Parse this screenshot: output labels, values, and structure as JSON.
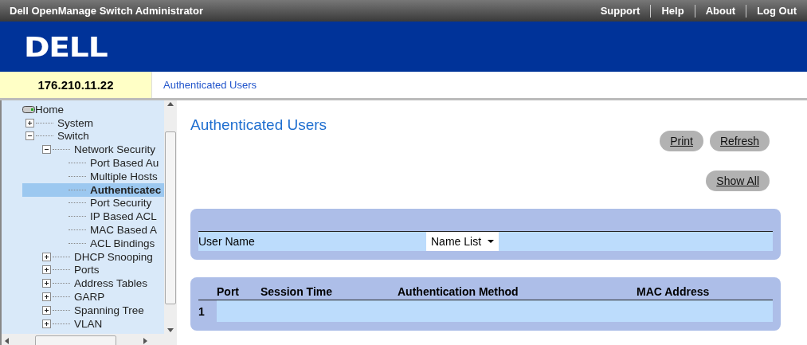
{
  "top_bar": {
    "title": "Dell OpenManage Switch Administrator",
    "links": [
      "Support",
      "Help",
      "About",
      "Log Out"
    ]
  },
  "logo": {
    "text": "DELL"
  },
  "address_bar": {
    "device_ip": "176.210.11.22",
    "breadcrumb": "Authenticated Users"
  },
  "tree": {
    "root": "Home",
    "items": [
      {
        "label": "System",
        "kind": "folder",
        "expanded": false,
        "selected": false
      },
      {
        "label": "Switch",
        "kind": "folder",
        "expanded": true,
        "selected": false,
        "children": [
          {
            "label": "Network Security",
            "kind": "folder",
            "expanded": true,
            "selected": false,
            "children": [
              {
                "label": "Port Based Au",
                "kind": "leaf",
                "selected": false
              },
              {
                "label": "Multiple Hosts",
                "kind": "leaf",
                "selected": false
              },
              {
                "label": "Authenticatec",
                "kind": "leaf",
                "selected": true
              },
              {
                "label": "Port Security",
                "kind": "leaf",
                "selected": false
              },
              {
                "label": "IP Based ACL",
                "kind": "leaf",
                "selected": false
              },
              {
                "label": "MAC Based A",
                "kind": "leaf",
                "selected": false
              },
              {
                "label": "ACL Bindings",
                "kind": "leaf",
                "selected": false
              }
            ]
          },
          {
            "label": "DHCP Snooping",
            "kind": "folder",
            "expanded": false,
            "selected": false
          },
          {
            "label": "Ports",
            "kind": "folder",
            "expanded": false,
            "selected": false
          },
          {
            "label": "Address Tables",
            "kind": "folder",
            "expanded": false,
            "selected": false
          },
          {
            "label": "GARP",
            "kind": "folder",
            "expanded": false,
            "selected": false
          },
          {
            "label": "Spanning Tree",
            "kind": "folder",
            "expanded": false,
            "selected": false
          },
          {
            "label": "VLAN",
            "kind": "folder",
            "expanded": false,
            "selected": false
          }
        ]
      }
    ]
  },
  "page": {
    "title": "Authenticated Users",
    "buttons": [
      "Print",
      "Refresh"
    ],
    "show_all_button": "Show All",
    "filter": {
      "label": "User Name",
      "select_value": "Name List"
    },
    "table": {
      "columns": [
        "Port",
        "Session Time",
        "Authentication Method",
        "MAC Address"
      ],
      "rows": [
        {
          "row_number": "1"
        }
      ]
    }
  }
}
